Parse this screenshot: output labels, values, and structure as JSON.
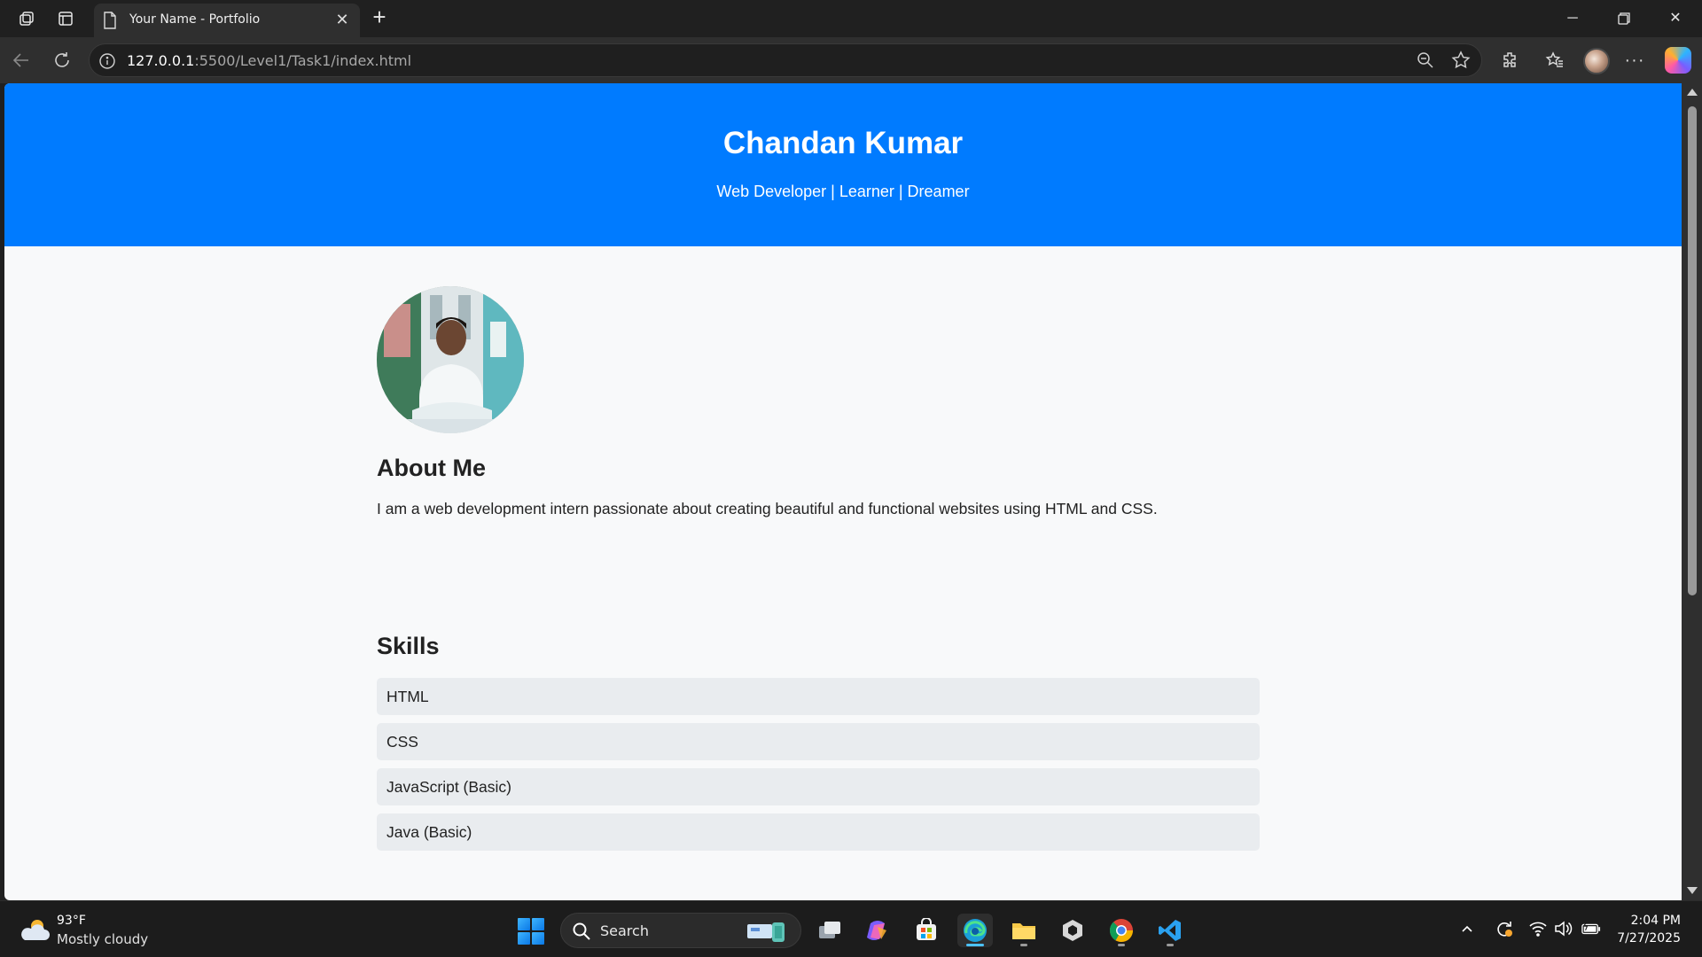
{
  "browser": {
    "tab_title": "Your Name - Portfolio",
    "url_host": "127.0.0.1",
    "url_path": ":5500/Level1/Task1/index.html"
  },
  "page": {
    "hero": {
      "name": "Chandan Kumar",
      "tagline": "Web Developer | Learner | Dreamer",
      "background": "#007bff"
    },
    "about": {
      "heading": "About Me",
      "text": "I am a web development intern passionate about creating beautiful and functional websites using HTML and CSS."
    },
    "skills": {
      "heading": "Skills",
      "items": [
        "HTML",
        "CSS",
        "JavaScript (Basic)",
        "Java (Basic)"
      ]
    }
  },
  "taskbar": {
    "weather_temp": "93°F",
    "weather_desc": "Mostly cloudy",
    "search_label": "Search",
    "time": "2:04 PM",
    "date": "7/27/2025"
  }
}
